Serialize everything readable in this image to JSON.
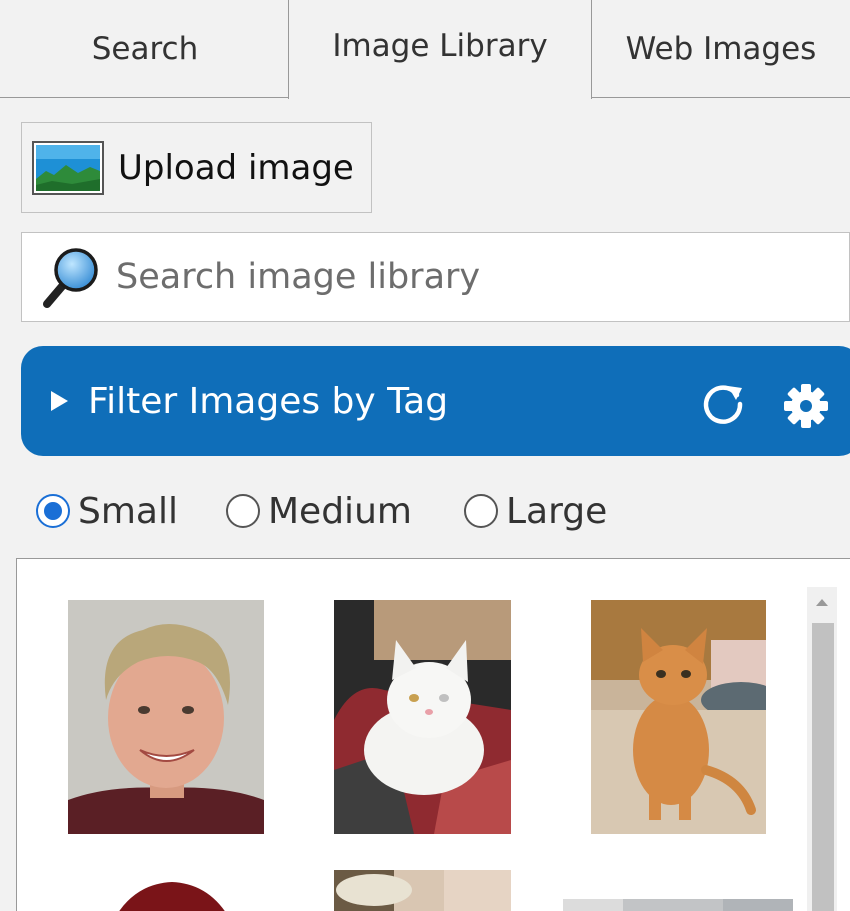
{
  "tabs": [
    {
      "label": "Search"
    },
    {
      "label": "Image Library"
    },
    {
      "label": "Web Images"
    }
  ],
  "active_tab": "Image Library",
  "upload": {
    "label": "Upload image",
    "icon": "landscape-image-icon"
  },
  "search": {
    "placeholder": "Search image library",
    "value": "",
    "icon": "magnifier-icon"
  },
  "filter": {
    "title": "Filter Images by Tag",
    "icons": [
      "disclosure-triangle-icon",
      "refresh-icon",
      "gear-icon"
    ]
  },
  "sizes": {
    "options": [
      {
        "label": "Small"
      },
      {
        "label": "Medium"
      },
      {
        "label": "Large"
      }
    ],
    "selected": "Small"
  },
  "colors": {
    "accent": "#0f6eb9",
    "radio_selected": "#1a6fd6",
    "panel_bg": "#f2f2f2"
  }
}
